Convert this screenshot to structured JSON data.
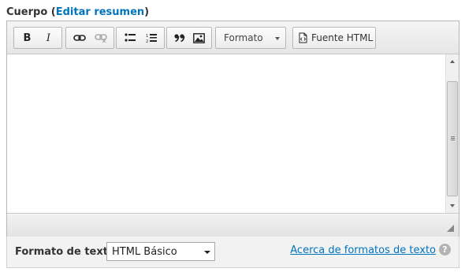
{
  "field": {
    "label": "Cuerpo",
    "open_paren": "(",
    "edit_summary_link": "Editar resumen",
    "close_paren": ")"
  },
  "toolbar": {
    "bold_label": "B",
    "italic_label": "I",
    "format_dropdown": "Formato",
    "source_label": "Fuente HTML",
    "icons": [
      "bold-icon",
      "italic-icon",
      "link-icon",
      "unlink-icon",
      "bulleted-list-icon",
      "numbered-list-icon",
      "blockquote-icon",
      "image-icon",
      "source-icon"
    ]
  },
  "content": {
    "text": ""
  },
  "text_format": {
    "label": "Formato de texto",
    "selected": "HTML Básico",
    "about_link": "Acerca de formatos de texto",
    "help_icon": "?"
  },
  "colors": {
    "link": "#0074bd"
  }
}
